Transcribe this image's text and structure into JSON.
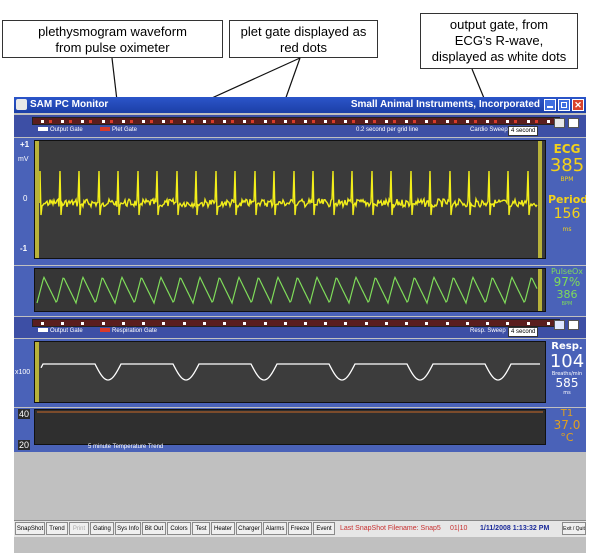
{
  "annotations": {
    "pleth": [
      "plethysmogram waveform",
      "from pulse oximeter"
    ],
    "plet_gate": [
      "plet gate displayed as",
      "red dots"
    ],
    "output_gate": [
      "output gate, from",
      "ECG's R-wave,",
      "displayed as white dots"
    ]
  },
  "window": {
    "title": "SAM PC Monitor",
    "company": "Small Animal Instruments, Incorporated",
    "close_glyph": "✕"
  },
  "ecg_panel": {
    "legend_output": "Output Gate",
    "legend_plet": "Plet Gate",
    "grid_info": "0.2 second per grid line",
    "sweep_label": "Cardio Sweep",
    "sweep_value": "4 second",
    "scale_top": "+1",
    "scale_unit": "mV",
    "scale_zero": "0",
    "scale_bottom": "-1",
    "ecg_title": "ECG",
    "ecg_value": "385",
    "ecg_unit": "BPM",
    "period_title": "Period",
    "period_value": "156",
    "period_unit": "ms"
  },
  "pulse_panel": {
    "title": "PulseOx",
    "spo2": "97%",
    "rate": "386",
    "rate_unit": "BPM"
  },
  "resp_panel": {
    "legend_output": "Output Gate",
    "legend_resp": "Respiration Gate",
    "sweep_label": "Resp. Sweep",
    "sweep_value": "4 second",
    "scale": "x100",
    "title": "Resp.",
    "value": "104",
    "unit": "Breaths/min",
    "ms_value": "585",
    "ms_unit": "ms"
  },
  "temp_panel": {
    "scale_top": "40",
    "scale_bottom": "20",
    "trend_label": "5 minute Temperature Trend",
    "title": "T1",
    "value": "37.0",
    "unit": "°C"
  },
  "toolbar": {
    "buttons": [
      "SnapShot",
      "Trend",
      "Print",
      "Gating",
      "Sys Info",
      "Bit Out",
      "Colors",
      "Test",
      "Heater",
      "Charger",
      "Alarms",
      "Freeze",
      "Event"
    ],
    "last_snapshot": "Last SnapShot Filename: Snap5",
    "counter": "01|10",
    "datetime": "1/11/2008 1:13:32 PM",
    "exit": "Exit / Quit"
  },
  "colors": {
    "ecg_trace": "#f2ee1a",
    "pleth_trace": "#7fdc5a",
    "resp_trace": "#ffffff",
    "ecg_readout": "#f3d21a",
    "pulse_readout": "#7fdc5a",
    "temp_readout": "#e0a020",
    "plet_gate": "#d83a2a"
  }
}
